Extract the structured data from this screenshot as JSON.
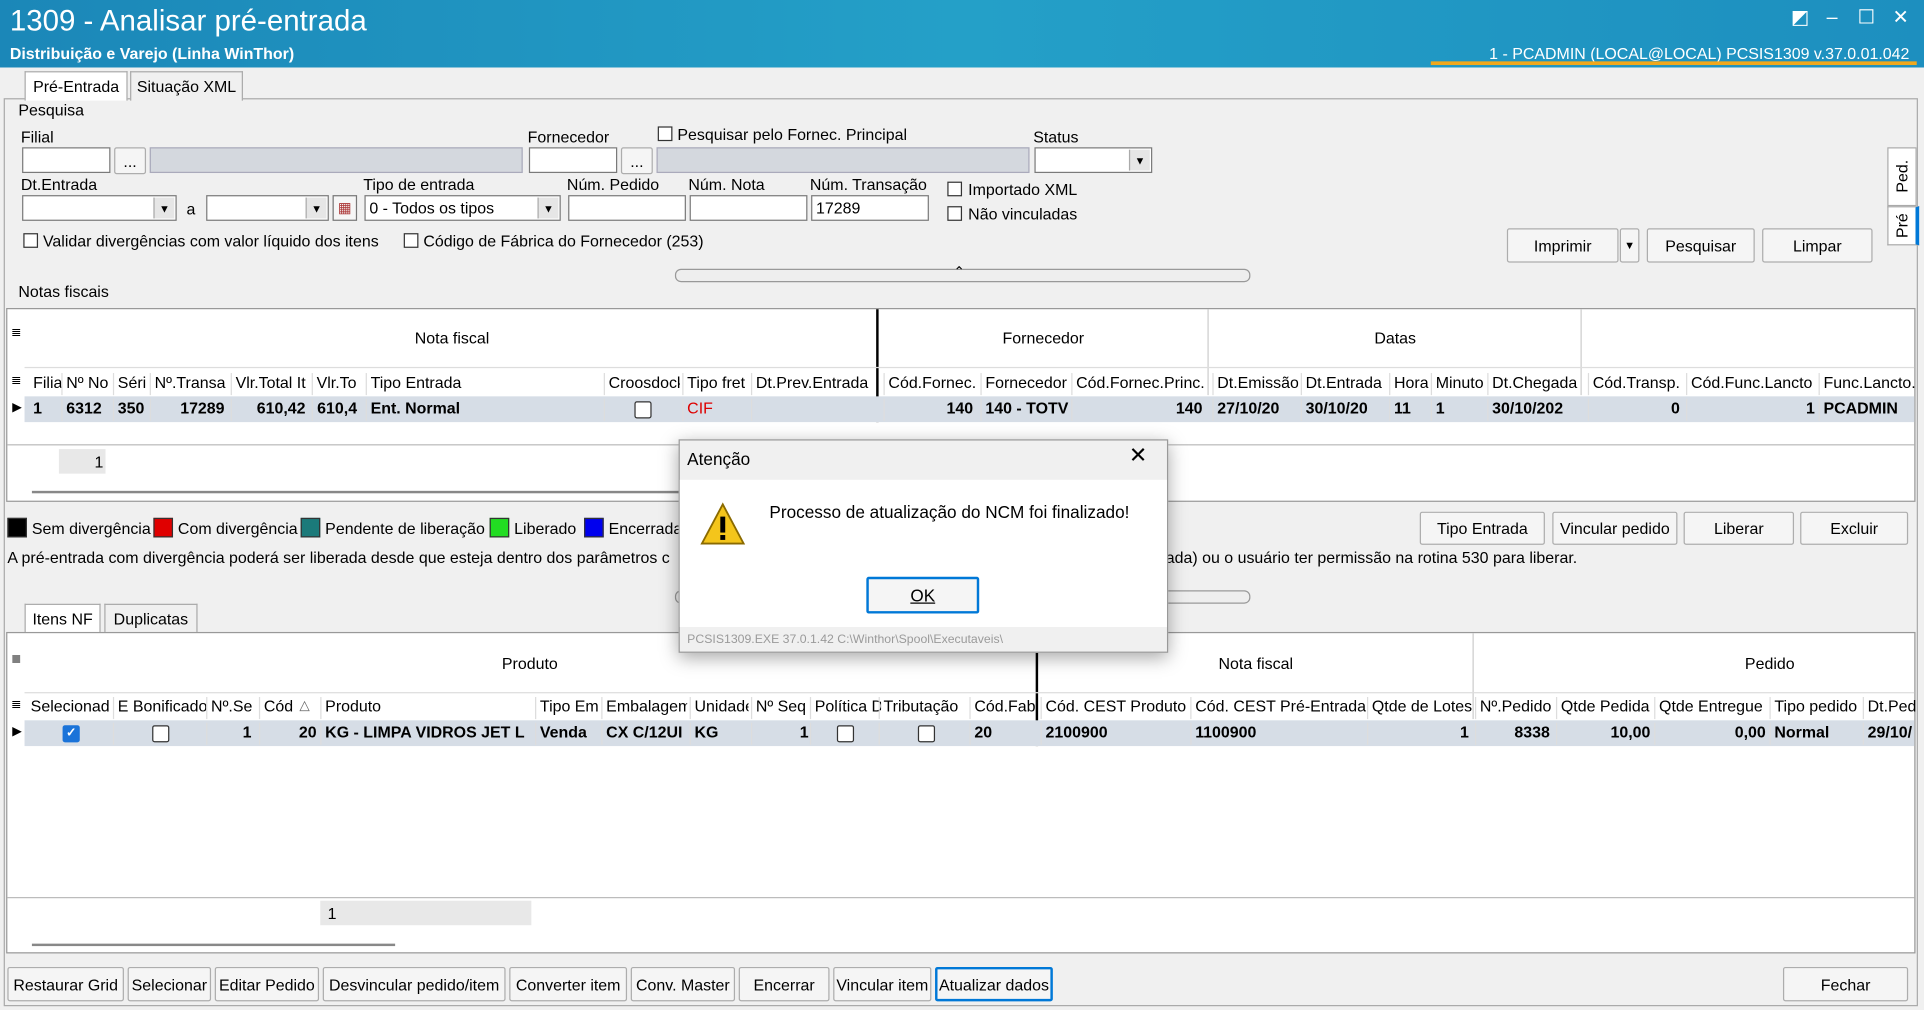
{
  "window": {
    "title": "1309 - Analisar pré-entrada",
    "subtitle": "Distribuição e Varejo (Linha WinThor)",
    "session": "1 - PCADMIN (LOCAL@LOCAL)   PCSIS1309  v.37.0.01.042",
    "accent_color": "#f0a81d",
    "titlebar_color": "#1b87b8"
  },
  "top_tabs": [
    "Pré-Entrada",
    "Situação XML"
  ],
  "side_tabs": [
    "Ped.",
    "Pré"
  ],
  "search": {
    "section_label": "Pesquisa",
    "filial_label": "Filial",
    "fornecedor_label": "Fornecedor",
    "fornec_principal_label": "Pesquisar pelo Fornec. Principal",
    "status_label": "Status",
    "dt_entrada_label": "Dt.Entrada",
    "a_label": "a",
    "tipo_entrada_label": "Tipo de entrada",
    "tipo_entrada_value": "0 - Todos os tipos",
    "num_pedido_label": "Núm. Pedido",
    "num_nota_label": "Núm. Nota",
    "num_transacao_label": "Núm. Transação",
    "num_transacao_value": "17289",
    "importado_xml_label": "Importado XML",
    "nao_vinculadas_label": "Não vinculadas",
    "validar_label": "Validar divergências com valor líquido dos itens",
    "codigo_fabrica_label": "Código de Fábrica do Fornecedor (253)",
    "ellipsis": "...",
    "imprimir": "Imprimir",
    "pesquisar": "Pesquisar",
    "limpar": "Limpar"
  },
  "notas": {
    "section_label": "Notas fiscais",
    "group_headers": [
      "Nota fiscal",
      "Fornecedor",
      "Datas"
    ],
    "columns": [
      "Filia",
      "Nº No",
      "Séri",
      "Nº.Transa",
      "Vlr.Total It",
      "Vlr.To",
      "Tipo Entrada",
      "Croosdock",
      "Tipo fret",
      "Dt.Prev.Entrada",
      "Cód.Fornec.",
      "Fornecedor",
      "Cód.Fornec.Princ.",
      "Dt.Emissão",
      "Dt.Entrada",
      "Hora",
      "Minuto",
      "Dt.Chegada",
      "Cód.Transp.",
      "Cód.Func.Lancto",
      "Func.Lancto."
    ],
    "row": [
      "1",
      "6312",
      "350",
      "17289",
      "610,42",
      "610,4",
      "Ent. Normal",
      "",
      "CIF",
      "",
      "140",
      "140 - TOTV",
      "140",
      "27/10/20",
      "30/10/20",
      "11",
      "1",
      "30/10/202",
      "0",
      "1",
      "PCADMIN"
    ],
    "footer_count": "1"
  },
  "legend": [
    {
      "label": "Sem divergência",
      "color": "#000000"
    },
    {
      "label": "Com divergência",
      "color": "#e00000"
    },
    {
      "label": "Pendente de liberação",
      "color": "#1b7a7a"
    },
    {
      "label": "Liberado",
      "color": "#22dd22"
    },
    {
      "label": "Encerrada",
      "color": "#0000ee"
    }
  ],
  "info_left": "A pré-entrada com divergência poderá ser liberada desde que esteja dentro dos parâmetros c",
  "info_right": "ada) ou o usuário ter permissão na rotina 530 para liberar.",
  "actions": [
    "Tipo Entrada",
    "Vincular pedido",
    "Liberar",
    "Excluir"
  ],
  "item_tabs": [
    "Itens NF",
    "Duplicatas"
  ],
  "itens": {
    "group_headers": [
      "Produto",
      "Nota fiscal",
      "Pedido"
    ],
    "columns": [
      "Selecionad",
      "E Bonificado",
      "Nº.Se",
      "Cód",
      "Produto",
      "Tipo Eml",
      "Embalagem",
      "Unidade",
      "Nº Seq",
      "Política D",
      "Tributação",
      "Cód.Fab",
      "Cód. CEST Produto",
      "Cód. CEST Pré-Entrada",
      "Qtde de Lotes",
      "Nº.Pedido",
      "Qtde Pedida",
      "Qtde Entregue",
      "Tipo pedido",
      "Dt.Pedi"
    ],
    "row": [
      "",
      "",
      "1",
      "20",
      "KG - LIMPA VIDROS JET L",
      "Venda",
      "CX C/12UI",
      "KG",
      "1",
      "",
      "",
      "20",
      "2100900",
      "1100900",
      "1",
      "8338",
      "10,00",
      "0,00",
      "Normal",
      "29/10/"
    ],
    "sort_indicator": "△",
    "footer_count": "1"
  },
  "bottom_buttons": [
    "Restaurar Grid",
    "Selecionar",
    "Editar Pedido",
    "Desvincular pedido/item",
    "Converter item",
    "Conv. Master",
    "Encerrar",
    "Vincular item",
    "Atualizar dados"
  ],
  "fechar": "Fechar",
  "dialog": {
    "title": "Atenção",
    "message": "Processo de atualização do NCM foi finalizado!",
    "ok": "OK",
    "footer": "PCSIS1309.EXE 37.0.1.42 C:\\Winthor\\Spool\\Executaveis\\"
  }
}
